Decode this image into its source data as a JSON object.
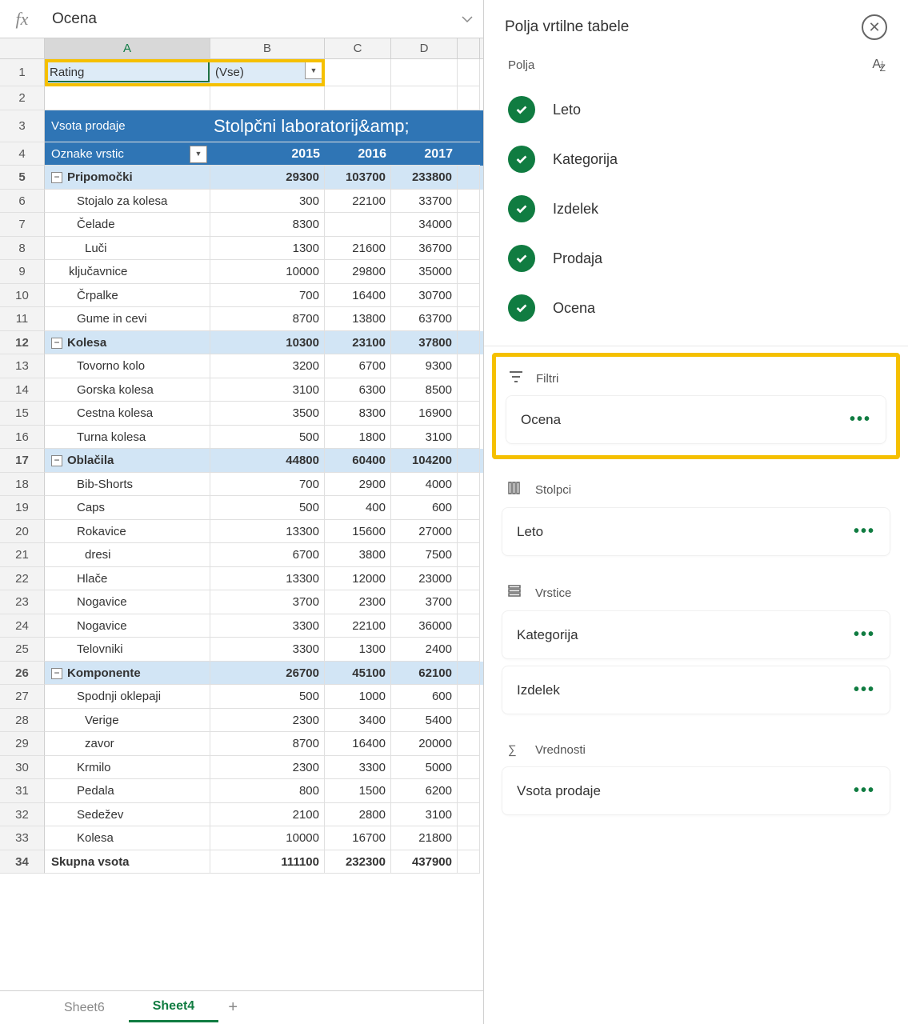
{
  "formula": "Ocena",
  "columns": [
    "A",
    "B",
    "C",
    "D"
  ],
  "row1": {
    "label": "Rating",
    "value": "(Vse)"
  },
  "pivotHeader": {
    "measure": "Vsota prodaje",
    "colLabel": "Stolpčni laboratorij&amp;",
    "rowLabel": "Oznake vrstic",
    "y1": "2015",
    "y2": "2016",
    "y3": "2017"
  },
  "rows": [
    {
      "n": 5,
      "t": "cat",
      "a": "Pripomočki",
      "b": "29300",
      "c": "103700",
      "d": "233800"
    },
    {
      "n": 6,
      "t": "item",
      "a": "Stojalo za kolesa",
      "b": "300",
      "c": "22100",
      "d": "33700"
    },
    {
      "n": 7,
      "t": "item",
      "a": "Čelade",
      "b": "8300",
      "c": "",
      "d": "34000"
    },
    {
      "n": 8,
      "t": "item2",
      "a": "Luči",
      "b": "1300",
      "c": "21600",
      "d": "36700"
    },
    {
      "n": 9,
      "t": "item",
      "a": "ključavnice",
      "b": "10000",
      "c": "29800",
      "d": "35000",
      "pad": "30"
    },
    {
      "n": 10,
      "t": "item",
      "a": "Črpalke",
      "b": "700",
      "c": "16400",
      "d": "30700"
    },
    {
      "n": 11,
      "t": "item",
      "a": "Gume in cevi",
      "b": "8700",
      "c": "13800",
      "d": "63700"
    },
    {
      "n": 12,
      "t": "cat",
      "a": "Kolesa",
      "b": "10300",
      "c": "23100",
      "d": "37800"
    },
    {
      "n": 13,
      "t": "item",
      "a": "Tovorno kolo",
      "b": "3200",
      "c": "6700",
      "d": "9300"
    },
    {
      "n": 14,
      "t": "item",
      "a": "Gorska kolesa",
      "b": "3100",
      "c": "6300",
      "d": "8500"
    },
    {
      "n": 15,
      "t": "item",
      "a": "Cestna kolesa",
      "b": "3500",
      "c": "8300",
      "d": "16900"
    },
    {
      "n": 16,
      "t": "item",
      "a": "Turna kolesa",
      "b": "500",
      "c": "1800",
      "d": "3100"
    },
    {
      "n": 17,
      "t": "cat",
      "a": "Oblačila",
      "b": "44800",
      "c": "60400",
      "d": "104200"
    },
    {
      "n": 18,
      "t": "item",
      "a": "Bib-Shorts",
      "b": "700",
      "c": "2900",
      "d": "4000"
    },
    {
      "n": 19,
      "t": "item",
      "a": "Caps",
      "b": "500",
      "c": "400",
      "d": "600"
    },
    {
      "n": 20,
      "t": "item",
      "a": "Rokavice",
      "b": "13300",
      "c": "15600",
      "d": "27000"
    },
    {
      "n": 21,
      "t": "item2",
      "a": "dresi",
      "b": "6700",
      "c": "3800",
      "d": "7500"
    },
    {
      "n": 22,
      "t": "item",
      "a": "Hlače",
      "b": "13300",
      "c": "12000",
      "d": "23000"
    },
    {
      "n": 23,
      "t": "item",
      "a": "Nogavice",
      "b": "3700",
      "c": "2300",
      "d": "3700"
    },
    {
      "n": 24,
      "t": "item",
      "a": "Nogavice",
      "b": "3300",
      "c": "22100",
      "d": "36000"
    },
    {
      "n": 25,
      "t": "item",
      "a": "Telovniki",
      "b": "3300",
      "c": "1300",
      "d": "2400"
    },
    {
      "n": 26,
      "t": "cat",
      "a": "Komponente",
      "b": "26700",
      "c": "45100",
      "d": "62100"
    },
    {
      "n": 27,
      "t": "item",
      "a": "Spodnji oklepaji",
      "b": "500",
      "c": "1000",
      "d": "600"
    },
    {
      "n": 28,
      "t": "item2",
      "a": "Verige",
      "b": "2300",
      "c": "3400",
      "d": "5400"
    },
    {
      "n": 29,
      "t": "item2",
      "a": "zavor",
      "b": "8700",
      "c": "16400",
      "d": "20000"
    },
    {
      "n": 30,
      "t": "item",
      "a": "Krmilo",
      "b": "2300",
      "c": "3300",
      "d": "5000"
    },
    {
      "n": 31,
      "t": "item",
      "a": "Pedala",
      "b": "800",
      "c": "1500",
      "d": "6200"
    },
    {
      "n": 32,
      "t": "item",
      "a": "Sedežev",
      "b": "2100",
      "c": "2800",
      "d": "3100"
    },
    {
      "n": 33,
      "t": "item",
      "a": "Kolesa",
      "b": "10000",
      "c": "16700",
      "d": "21800"
    },
    {
      "n": 34,
      "t": "grand",
      "a": "Skupna vsota",
      "b": "111100",
      "c": "232300",
      "d": "437900"
    }
  ],
  "tabs": {
    "t1": "Sheet6",
    "t2": "Sheet4"
  },
  "panel": {
    "title": "Polja vrtilne tabele",
    "fieldsLabel": "Polja",
    "fields": [
      "Leto",
      "Kategorija",
      "Izdelek",
      "Prodaja",
      "Ocena"
    ],
    "filtersLabel": "Filtri",
    "filterItem": "Ocena",
    "columnsLabel": "Stolpci",
    "columnItem": "Leto",
    "rowsLabel": "Vrstice",
    "rowItem1": "Kategorija",
    "rowItem2": "Izdelek",
    "valuesLabel": "Vrednosti",
    "valueItem": "Vsota prodaje"
  }
}
